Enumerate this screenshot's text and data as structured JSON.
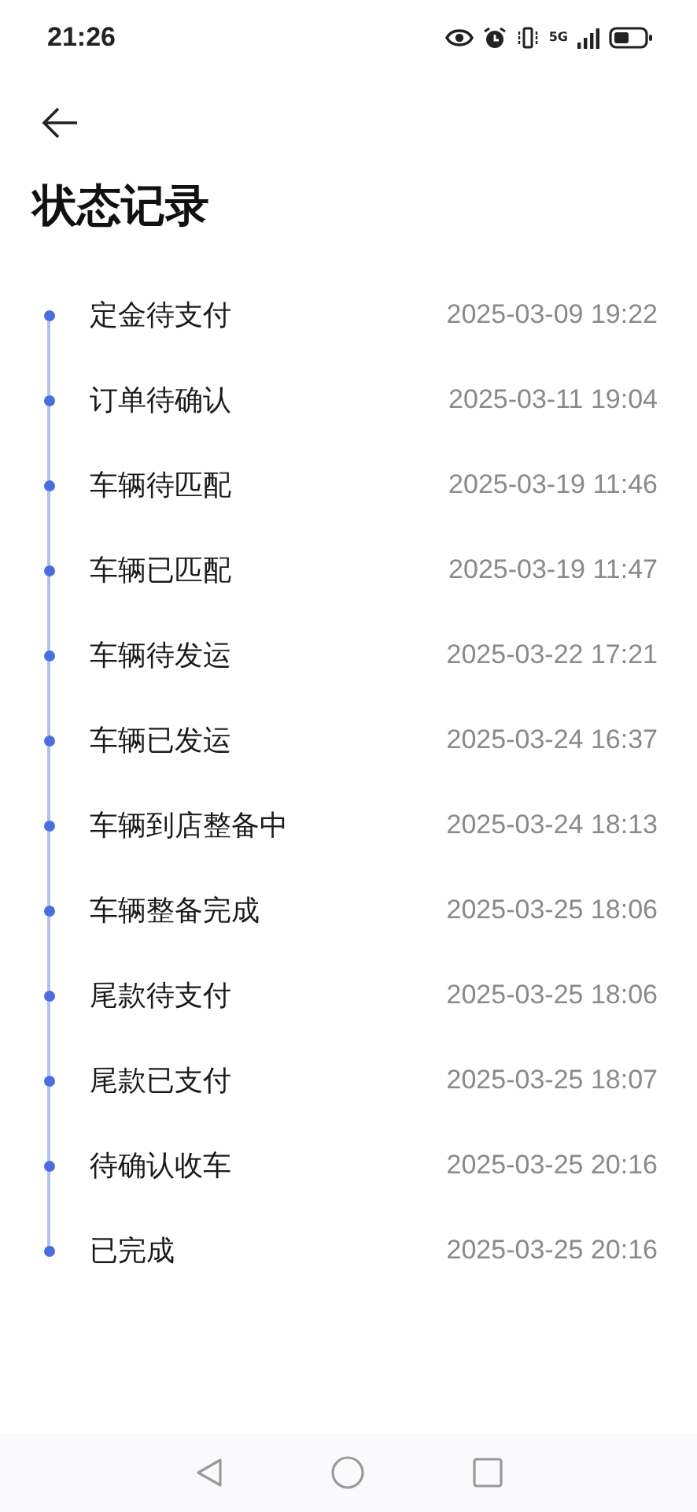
{
  "status_bar": {
    "time": "21:26",
    "network": "5G"
  },
  "title": "状态记录",
  "records": [
    {
      "status": "定金待支付",
      "time": "2025-03-09 19:22"
    },
    {
      "status": "订单待确认",
      "time": "2025-03-11 19:04"
    },
    {
      "status": "车辆待匹配",
      "time": "2025-03-19 11:46"
    },
    {
      "status": "车辆已匹配",
      "time": "2025-03-19 11:47"
    },
    {
      "status": "车辆待发运",
      "time": "2025-03-22 17:21"
    },
    {
      "status": "车辆已发运",
      "time": "2025-03-24 16:37"
    },
    {
      "status": "车辆到店整备中",
      "time": "2025-03-24 18:13"
    },
    {
      "status": "车辆整备完成",
      "time": "2025-03-25 18:06"
    },
    {
      "status": "尾款待支付",
      "time": "2025-03-25 18:06"
    },
    {
      "status": "尾款已支付",
      "time": "2025-03-25 18:07"
    },
    {
      "status": "待确认收车",
      "time": "2025-03-25 20:16"
    },
    {
      "status": "已完成",
      "time": "2025-03-25 20:16"
    }
  ]
}
